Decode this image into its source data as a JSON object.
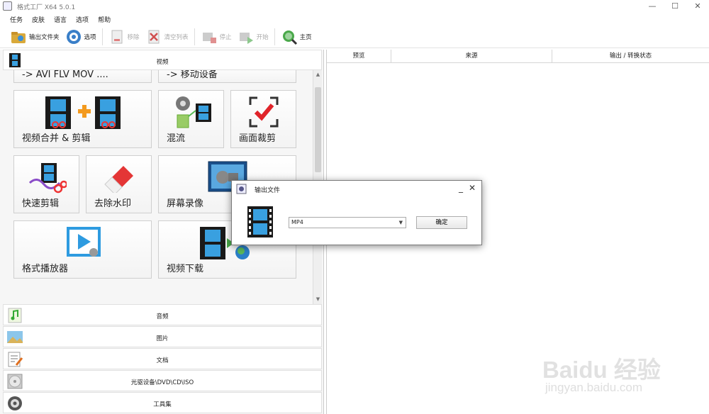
{
  "window": {
    "title": "格式工厂 X64 5.0.1",
    "min": "—",
    "max": "☐",
    "close": "✕"
  },
  "menu": [
    "任务",
    "皮肤",
    "语言",
    "选项",
    "帮助"
  ],
  "toolbar": {
    "output_folder": "输出文件夹",
    "options": "选项",
    "remove": "移除",
    "clear_list": "清空列表",
    "stop": "停止",
    "start": "开始",
    "home": "主页"
  },
  "left": {
    "video_header": "视频",
    "tiles": {
      "avi": "-> AVI FLV MOV ....",
      "mobile": "-> 移动设备",
      "merge": "视频合并 & 剪辑",
      "mux": "混流",
      "crop": "画面裁剪",
      "quick_cut": "快速剪辑",
      "watermark": "去除水印",
      "screen_record": "屏幕录像",
      "player": "格式播放器",
      "download": "视频下载"
    },
    "categories": {
      "audio": "音频",
      "picture": "图片",
      "document": "文档",
      "disc": "光驱设备\\DVD\\CD\\ISO",
      "tools": "工具集"
    }
  },
  "columns": {
    "preview": "预览",
    "source": "来源",
    "output": "输出 / 转换状态"
  },
  "dialog": {
    "title": "输出文件",
    "min": "_",
    "close": "✕",
    "format": "MP4",
    "ok": "确定"
  },
  "watermark": {
    "brand": "Baidu 经验",
    "url": "jingyan.baidu.com"
  },
  "colors": {
    "accent": "#3a8fd8",
    "film": "#1a1a1a",
    "film_blue": "#39a0e0",
    "check_red": "#e0242a"
  }
}
